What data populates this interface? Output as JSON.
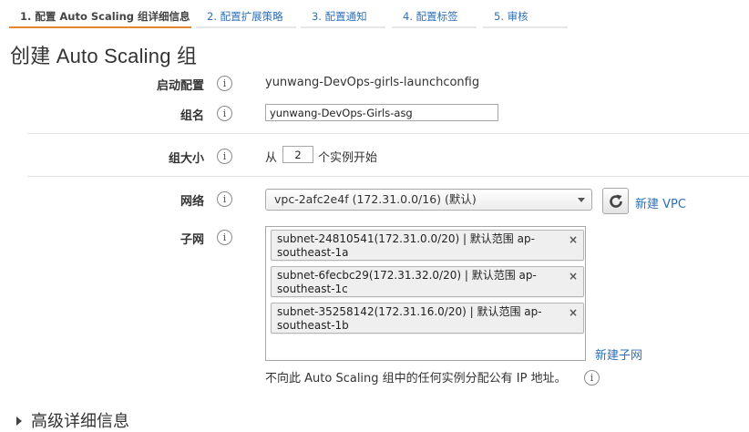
{
  "tabs": [
    {
      "label": "1. 配置 Auto Scaling 组详细信息",
      "active": true
    },
    {
      "label": "2. 配置扩展策略"
    },
    {
      "label": "3. 配置通知"
    },
    {
      "label": "4. 配置标签"
    },
    {
      "label": "5. 审核"
    }
  ],
  "page_title": "创建 Auto Scaling 组",
  "info_icon_glyph": "i",
  "form": {
    "launch_config": {
      "label": "启动配置",
      "value": "yunwang-DevOps-girls-launchconfig"
    },
    "group_name": {
      "label": "组名",
      "value": "yunwang-DevOps-Girls-asg"
    },
    "group_size": {
      "label": "组大小",
      "prefix": "从",
      "value": "2",
      "suffix": "个实例开始"
    },
    "network": {
      "label": "网络",
      "selected": "vpc-2afc2e4f (172.31.0.0/16) (默认)",
      "new_vpc_link": "新建 VPC"
    },
    "subnet": {
      "label": "子网",
      "chips": [
        "subnet-24810541(172.31.0.0/20) | 默认范围 ap-southeast-1a",
        "subnet-6fecbc29(172.31.32.0/20) | 默认范围 ap-southeast-1c",
        "subnet-35258142(172.31.16.0/20) | 默认范围 ap-southeast-1b"
      ],
      "chip_close": "×",
      "new_subnet_link": "新建子网",
      "public_ip_note": "不向此 Auto Scaling 组中的任何实例分配公有 IP 地址。"
    }
  },
  "advanced_details": "高级详细信息",
  "colors": {
    "link": "#2d70b8",
    "active_tab_underline": "#e8862d"
  }
}
